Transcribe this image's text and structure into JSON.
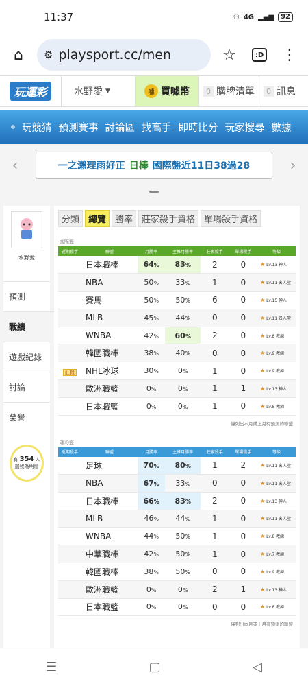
{
  "status": {
    "time": "11:37",
    "battery": "92",
    "signal": "4G"
  },
  "browser": {
    "url": "playsport.cc/men",
    "tab_label": ":D"
  },
  "site": {
    "logo": "玩運彩",
    "user": "水野愛",
    "coin_label": "買噱幣",
    "coin_icon": "噱",
    "cart_count": "0",
    "cart_label": "購牌清單",
    "msg_count": "0",
    "msg_label": "訊息"
  },
  "nav": [
    "玩競猜",
    "預測賽事",
    "討論區",
    "找高手",
    "即時比分",
    "玩家搜尋",
    "數據"
  ],
  "marquee": {
    "a": "一之瀨理雨好正",
    "b": "日棒",
    "c": "國際盤近11日38過28"
  },
  "sidebar": {
    "name": "水野愛",
    "items": [
      "預測",
      "戰績",
      "遊戲紀錄",
      "討論",
      "榮譽"
    ],
    "bulb": {
      "pre": "有",
      "count": "354",
      "unit": "人",
      "post": "加我為明燈"
    }
  },
  "tabs": [
    "分類",
    "總覽",
    "勝率",
    "莊家殺手資格",
    "單場殺手資格"
  ],
  "headers": [
    "近期殺手",
    "聯盟",
    "月勝率",
    "主推月勝率",
    "莊家殺手",
    "單場殺手",
    "等級"
  ],
  "section1": {
    "title": "國際盤",
    "rows": [
      {
        "tag": "",
        "league": "日本職棒",
        "m": "64",
        "p": "83",
        "z": "2",
        "d": "0",
        "lv": "Lv.13 神人",
        "hm": true,
        "hp": true
      },
      {
        "tag": "",
        "league": "NBA",
        "m": "50",
        "p": "33",
        "z": "1",
        "d": "0",
        "lv": "Lv.11 名人堂"
      },
      {
        "tag": "",
        "league": "賽馬",
        "m": "50",
        "p": "50",
        "z": "6",
        "d": "0",
        "lv": "Lv.15 神人"
      },
      {
        "tag": "",
        "league": "MLB",
        "m": "45",
        "p": "44",
        "z": "0",
        "d": "0",
        "lv": "Lv.11 名人堂"
      },
      {
        "tag": "",
        "league": "WNBA",
        "m": "42",
        "p": "60",
        "z": "2",
        "d": "0",
        "lv": "Lv.8 教練",
        "hp": true
      },
      {
        "tag": "",
        "league": "韓國職棒",
        "m": "38",
        "p": "40",
        "z": "0",
        "d": "0",
        "lv": "Lv.9 教練"
      },
      {
        "tag": "莊殺",
        "league": "NHL冰球",
        "m": "30",
        "p": "0",
        "z": "1",
        "d": "0",
        "lv": "Lv.9 教練"
      },
      {
        "tag": "",
        "league": "歐洲職籃",
        "m": "0",
        "p": "0",
        "z": "1",
        "d": "1",
        "lv": "Lv.13 神人"
      },
      {
        "tag": "",
        "league": "日本職籃",
        "m": "0",
        "p": "0",
        "z": "1",
        "d": "0",
        "lv": "Lv.8 教練"
      }
    ],
    "note": "僅列出本月或上月有預測的聯盟"
  },
  "section2": {
    "title": "運彩盤",
    "rows": [
      {
        "tag": "",
        "league": "足球",
        "m": "70",
        "p": "80",
        "z": "1",
        "d": "2",
        "lv": "Lv.11 名人堂",
        "hm": true,
        "hp": true
      },
      {
        "tag": "",
        "league": "NBA",
        "m": "67",
        "p": "33",
        "z": "0",
        "d": "0",
        "lv": "Lv.11 名人堂",
        "hm": true
      },
      {
        "tag": "",
        "league": "日本職棒",
        "m": "66",
        "p": "83",
        "z": "2",
        "d": "0",
        "lv": "Lv.13 神人",
        "hm": true,
        "hp": true
      },
      {
        "tag": "",
        "league": "MLB",
        "m": "46",
        "p": "44",
        "z": "1",
        "d": "0",
        "lv": "Lv.11 名人堂"
      },
      {
        "tag": "",
        "league": "WNBA",
        "m": "44",
        "p": "50",
        "z": "1",
        "d": "0",
        "lv": "Lv.8 教練"
      },
      {
        "tag": "",
        "league": "中華職棒",
        "m": "42",
        "p": "50",
        "z": "1",
        "d": "0",
        "lv": "Lv.7 教練"
      },
      {
        "tag": "",
        "league": "韓國職棒",
        "m": "38",
        "p": "50",
        "z": "0",
        "d": "0",
        "lv": "Lv.9 教練"
      },
      {
        "tag": "",
        "league": "歐洲職籃",
        "m": "0",
        "p": "0",
        "z": "2",
        "d": "1",
        "lv": "Lv.13 神人"
      },
      {
        "tag": "",
        "league": "日本職籃",
        "m": "0",
        "p": "0",
        "z": "0",
        "d": "0",
        "lv": "Lv.8 教練"
      }
    ],
    "note": "僅列出本月或上月有預測的聯盟"
  },
  "colors": {
    "green_header": "#5aa82a",
    "blue_header": "#3a9ad8",
    "nav_blue": "#1f6fb8",
    "tab_active": "#f6ee60"
  },
  "icons": [
    "home-icon",
    "site-settings-icon",
    "star-icon",
    "tabs-icon",
    "more-vert-icon",
    "chevron-left-icon",
    "chevron-right-icon",
    "bulb-icon",
    "menu-icon",
    "square-icon",
    "back-triangle-icon"
  ]
}
